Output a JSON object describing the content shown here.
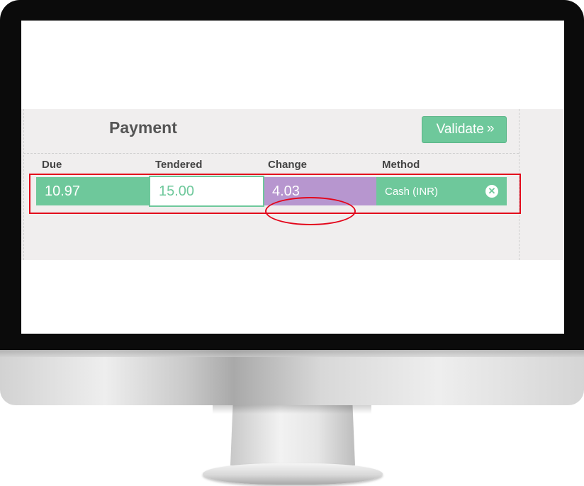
{
  "payment": {
    "title": "Payment",
    "validate_label": "Validate",
    "validate_icon": "chevron-double-right-icon",
    "columns": {
      "due": "Due",
      "tendered": "Tendered",
      "change": "Change",
      "method": "Method"
    },
    "line": {
      "due": "10.97",
      "tendered": "15.00",
      "change": "4.03",
      "method": "Cash (INR)",
      "remove_icon": "close-circle-icon"
    }
  },
  "colors": {
    "accent_green": "#6ec89b",
    "change_purple": "#b796cf",
    "highlight_red": "#e3061b"
  }
}
